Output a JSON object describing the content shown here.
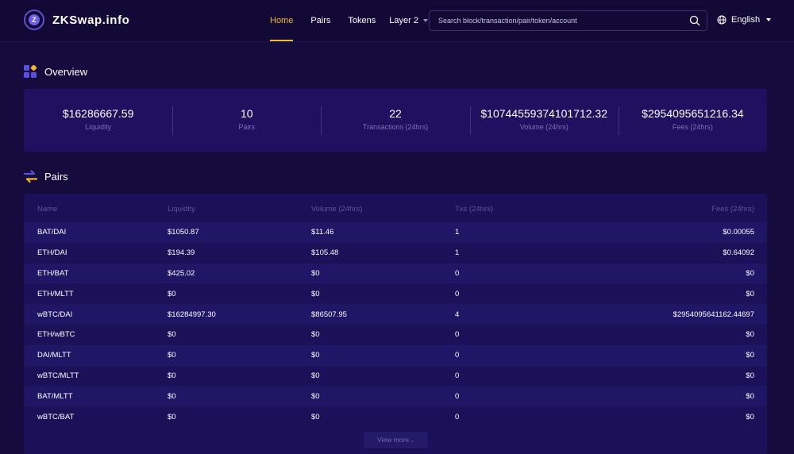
{
  "header": {
    "logo_text": "ZKSwap.info",
    "logo_glyph": "Z",
    "nav": [
      {
        "label": "Home",
        "active": true
      },
      {
        "label": "Pairs",
        "active": false
      },
      {
        "label": "Tokens",
        "active": false
      },
      {
        "label": "Layer 2",
        "active": false,
        "dropdown": true
      }
    ],
    "search_placeholder": "Search block/transaction/pair/token/account",
    "language": "English"
  },
  "overview": {
    "title": "Overview",
    "stats": [
      {
        "value": "$16286667.59",
        "caption": "Liquidity"
      },
      {
        "value": "10",
        "caption": "Pairs"
      },
      {
        "value": "22",
        "caption": "Transactions (24hrs)"
      },
      {
        "value": "$10744559374101712.32",
        "caption": "Volume (24hrs)"
      },
      {
        "value": "$2954095651216.34",
        "caption": "Fees (24hrs)"
      }
    ]
  },
  "pairs": {
    "title": "Pairs",
    "columns": [
      "Name",
      "Liquidity",
      "Volume (24hrs)",
      "Txs (24hrs)",
      "Fees (24hrs)"
    ],
    "rows": [
      [
        "BAT/DAI",
        "$1050.87",
        "$11.46",
        "1",
        "$0.00055"
      ],
      [
        "ETH/DAI",
        "$194.39",
        "$105.48",
        "1",
        "$0.64092"
      ],
      [
        "ETH/BAT",
        "$425.02",
        "$0",
        "0",
        "$0"
      ],
      [
        "ETH/MLTT",
        "$0",
        "$0",
        "0",
        "$0"
      ],
      [
        "wBTC/DAI",
        "$16284997.30",
        "$86507.95",
        "4",
        "$2954095641162.44697"
      ],
      [
        "ETH/wBTC",
        "$0",
        "$0",
        "0",
        "$0"
      ],
      [
        "DAI/MLTT",
        "$0",
        "$0",
        "0",
        "$0"
      ],
      [
        "wBTC/MLTT",
        "$0",
        "$0",
        "0",
        "$0"
      ],
      [
        "BAT/MLTT",
        "$0",
        "$0",
        "0",
        "$0"
      ],
      [
        "wBTC/BAT",
        "$0",
        "$0",
        "0",
        "$0"
      ]
    ],
    "view_more": "View more"
  },
  "colors": {
    "background": "#150b3c",
    "card": "#1f1160",
    "accent_active": "#f5b731",
    "muted_text": "#7a72b3"
  },
  "icons": {
    "logo": "zkswap-logo-icon",
    "search": "search-icon",
    "language": "globe-icon",
    "overview": "dashboard-grid-icon",
    "pairs": "swap-arrows-icon"
  }
}
